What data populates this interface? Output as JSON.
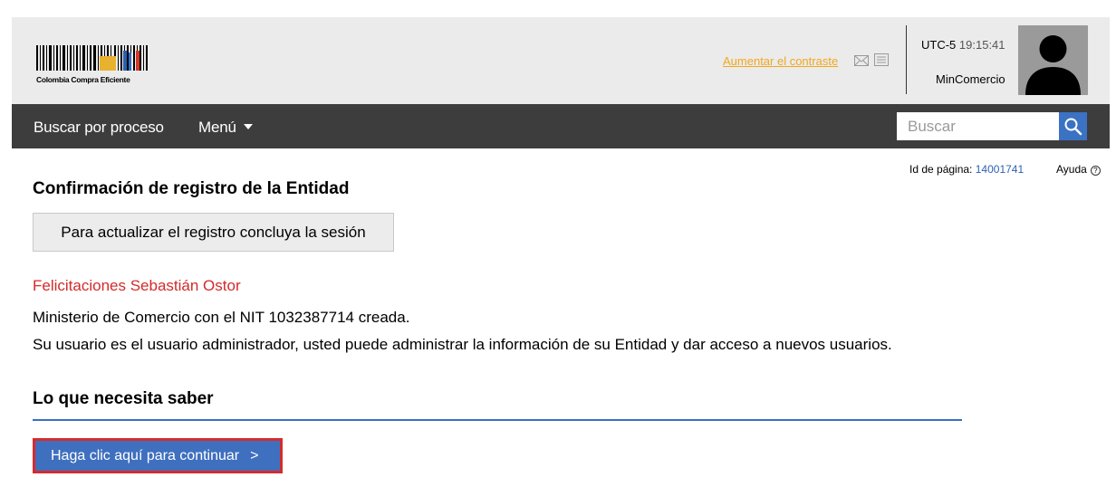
{
  "header": {
    "logo_text": "Colombia Compra Eficiente",
    "contrast_link": "Aumentar el contraste",
    "timezone_label": "UTC-5",
    "time": "19:15:41",
    "username": "MinComercio"
  },
  "navbar": {
    "search_process": "Buscar por proceso",
    "menu": "Menú",
    "search_placeholder": "Buscar"
  },
  "page_meta": {
    "page_id_label": "Id de página:",
    "page_id": "14001741",
    "help": "Ayuda",
    "help_symbol": "?"
  },
  "main": {
    "title": "Confirmación de registro de la Entidad",
    "update_button": "Para actualizar el registro concluya la sesión",
    "congrats": "Felicitaciones Sebastián Ostor",
    "message_line1": "Ministerio de Comercio con el NIT 1032387714 creada.",
    "message_line2": "Su usuario es el usuario administrador, usted puede administrar la información de su Entidad y dar acceso a nuevos usuarios.",
    "subtitle": "Lo que necesita saber",
    "continue_button": "Haga clic aquí para continuar",
    "continue_arrow": ">"
  },
  "colors": {
    "navbar_bg": "#3d3d3d",
    "header_bg": "#ebebeb",
    "link_orange": "#f0a81c",
    "congrats_red": "#d42a2a",
    "accent_blue": "#3f6fbf",
    "highlight_red": "#d62b2b"
  },
  "icons": [
    "mail-icon",
    "document-icon",
    "search-icon",
    "user-avatar-icon",
    "help-icon",
    "chevron-down-icon"
  ]
}
